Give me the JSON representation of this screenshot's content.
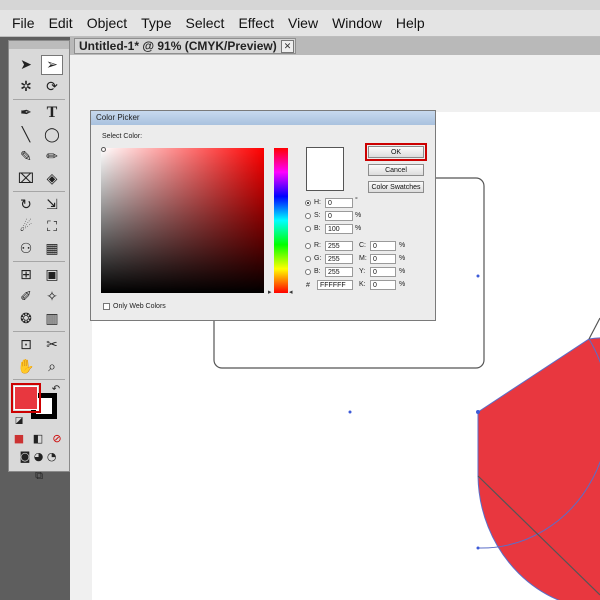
{
  "menu": [
    "File",
    "Edit",
    "Object",
    "Type",
    "Select",
    "Effect",
    "View",
    "Window",
    "Help"
  ],
  "document_tab": {
    "title": "Untitled-1* @ 91% (CMYK/Preview)",
    "close_label": "✕"
  },
  "colors": {
    "fill": "#e8373f",
    "highlight": "#cc0000"
  },
  "color_picker": {
    "title": "Color Picker",
    "select_color_label": "Select Color:",
    "only_web_colors_label": "Only Web Colors",
    "buttons": {
      "ok": "OK",
      "cancel": "Cancel",
      "swatches": "Color Swatches"
    },
    "hsb": [
      {
        "label": "H:",
        "value": "0",
        "unit": "°"
      },
      {
        "label": "S:",
        "value": "0",
        "unit": "%"
      },
      {
        "label": "B:",
        "value": "100",
        "unit": "%"
      }
    ],
    "rgb": [
      {
        "label": "R:",
        "value": "255"
      },
      {
        "label": "G:",
        "value": "255"
      },
      {
        "label": "B:",
        "value": "255"
      }
    ],
    "cmyk": [
      {
        "label": "C:",
        "value": "0",
        "unit": "%"
      },
      {
        "label": "M:",
        "value": "0",
        "unit": "%"
      },
      {
        "label": "Y:",
        "value": "0",
        "unit": "%"
      },
      {
        "label": "K:",
        "value": "0",
        "unit": "%"
      }
    ],
    "hex": {
      "label": "#",
      "value": "FFFFFF"
    }
  }
}
